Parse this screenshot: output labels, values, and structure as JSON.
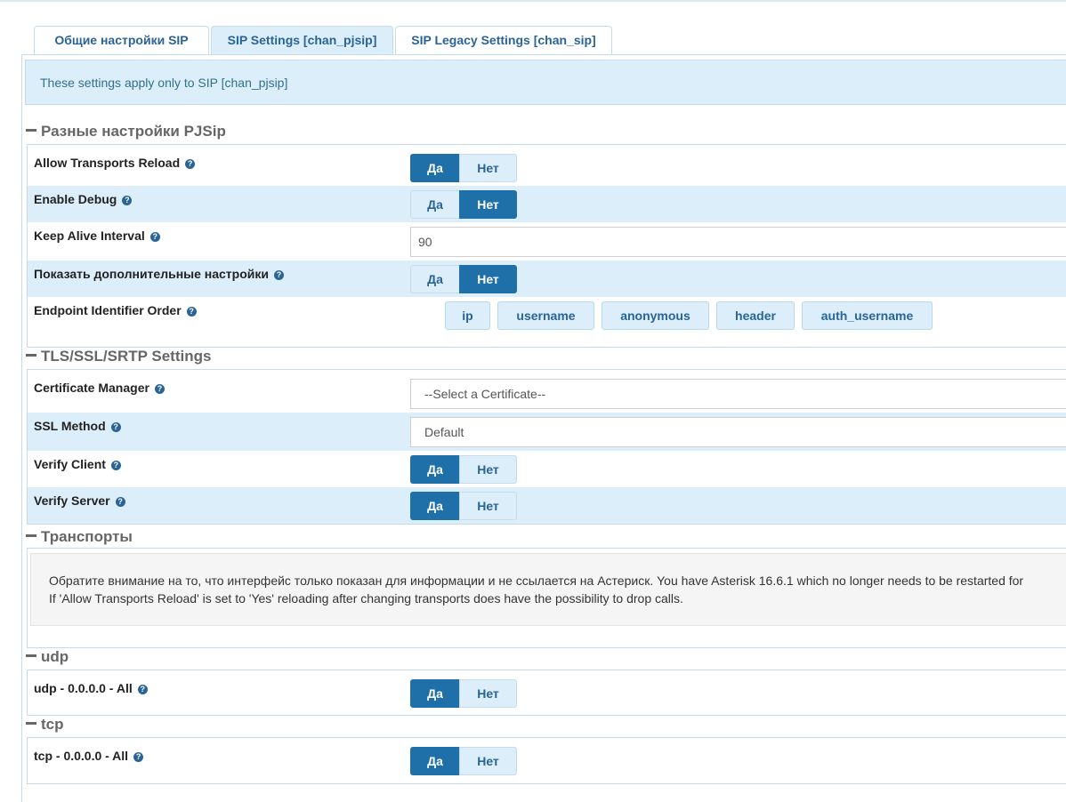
{
  "tabs": [
    {
      "label": "Общие настройки SIP",
      "active": false
    },
    {
      "label": "SIP Settings [chan_pjsip]",
      "active": true
    },
    {
      "label": "SIP Legacy Settings [chan_sip]",
      "active": false
    }
  ],
  "info": "These settings apply only to SIP [chan_pjsip]",
  "toggle": {
    "yes": "Да",
    "no": "Нет"
  },
  "sections": {
    "pjsip": {
      "title": "Разные настройки PJSip",
      "allow_transports_reload": {
        "label": "Allow Transports Reload",
        "value": "Да"
      },
      "enable_debug": {
        "label": "Enable Debug",
        "value": "Нет"
      },
      "keep_alive": {
        "label": "Keep Alive Interval",
        "value": "90"
      },
      "show_advanced": {
        "label": "Показать дополнительные настройки",
        "value": "Нет"
      },
      "endpoint_order": {
        "label": "Endpoint Identifier Order",
        "items": [
          "ip",
          "username",
          "anonymous",
          "header",
          "auth_username"
        ]
      }
    },
    "tls": {
      "title": "TLS/SSL/SRTP Settings",
      "cert_manager": {
        "label": "Certificate Manager",
        "value": "--Select a Certificate--"
      },
      "ssl_method": {
        "label": "SSL Method",
        "value": "Default"
      },
      "verify_client": {
        "label": "Verify Client",
        "value": "Да"
      },
      "verify_server": {
        "label": "Verify Server",
        "value": "Да"
      }
    },
    "transports": {
      "title": "Транспорты",
      "note_line1": "Обратите внимание на то, что интерфейс только показан для информации и не ссылается на Астериск. You have Asterisk 16.6.1 which no longer needs to be restarted for",
      "note_line2": "If 'Allow Transports Reload' is set to 'Yes' reloading after changing transports does have the possibility to drop calls."
    },
    "udp": {
      "title": "udp",
      "label": "udp - 0.0.0.0 - All",
      "value": "Да"
    },
    "tcp": {
      "title": "tcp",
      "label": "tcp - 0.0.0.0 - All",
      "value": "Да"
    }
  },
  "colors": {
    "accent": "#1f6fa8",
    "light": "#dbeef9",
    "border": "#c4dbe8"
  },
  "icons": {
    "help": "question-circle-icon",
    "collapse": "minus-icon"
  }
}
